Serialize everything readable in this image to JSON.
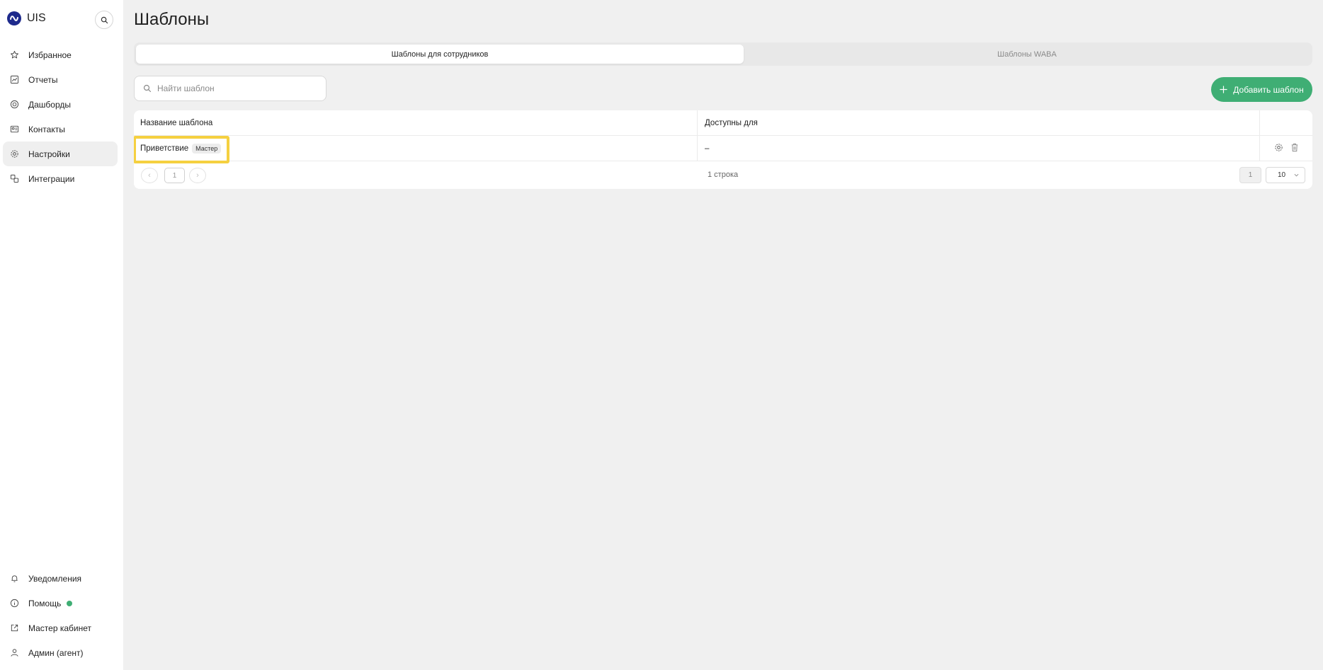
{
  "app": {
    "brand": "UIS"
  },
  "sidebar": {
    "items": [
      {
        "label": "Избранное",
        "icon": "star-icon"
      },
      {
        "label": "Отчеты",
        "icon": "reports-icon"
      },
      {
        "label": "Дашборды",
        "icon": "dashboard-icon"
      },
      {
        "label": "Контакты",
        "icon": "contacts-icon"
      },
      {
        "label": "Настройки",
        "icon": "gear-icon",
        "active": true
      },
      {
        "label": "Интеграции",
        "icon": "integrations-icon"
      }
    ],
    "bottom": [
      {
        "label": "Уведомления",
        "icon": "bell-icon"
      },
      {
        "label": "Помощь",
        "icon": "info-icon"
      },
      {
        "label": "Мастер кабинет",
        "icon": "external-link-icon"
      },
      {
        "label": "Админ (агент)",
        "icon": "user-icon"
      }
    ]
  },
  "page": {
    "title": "Шаблоны"
  },
  "tabs": [
    {
      "label": "Шаблоны для сотрудников",
      "active": true
    },
    {
      "label": "Шаблоны WABA",
      "active": false
    }
  ],
  "search": {
    "placeholder": "Найти шаблон"
  },
  "add_button": {
    "label": "Добавить шаблон"
  },
  "table": {
    "columns": [
      "Название шаблона",
      "Доступны для"
    ],
    "rows": [
      {
        "name": "Приветствие",
        "badge": "Мастер",
        "available_for": "–"
      }
    ]
  },
  "pagination": {
    "prev": "‹",
    "next": "›",
    "current_page": "1",
    "rows_count": "1 строка",
    "page_indicator": "1",
    "page_size": "10"
  },
  "colors": {
    "accent": "#3fae74",
    "highlight": "#f5d040",
    "brand": "#1e2a8c"
  }
}
